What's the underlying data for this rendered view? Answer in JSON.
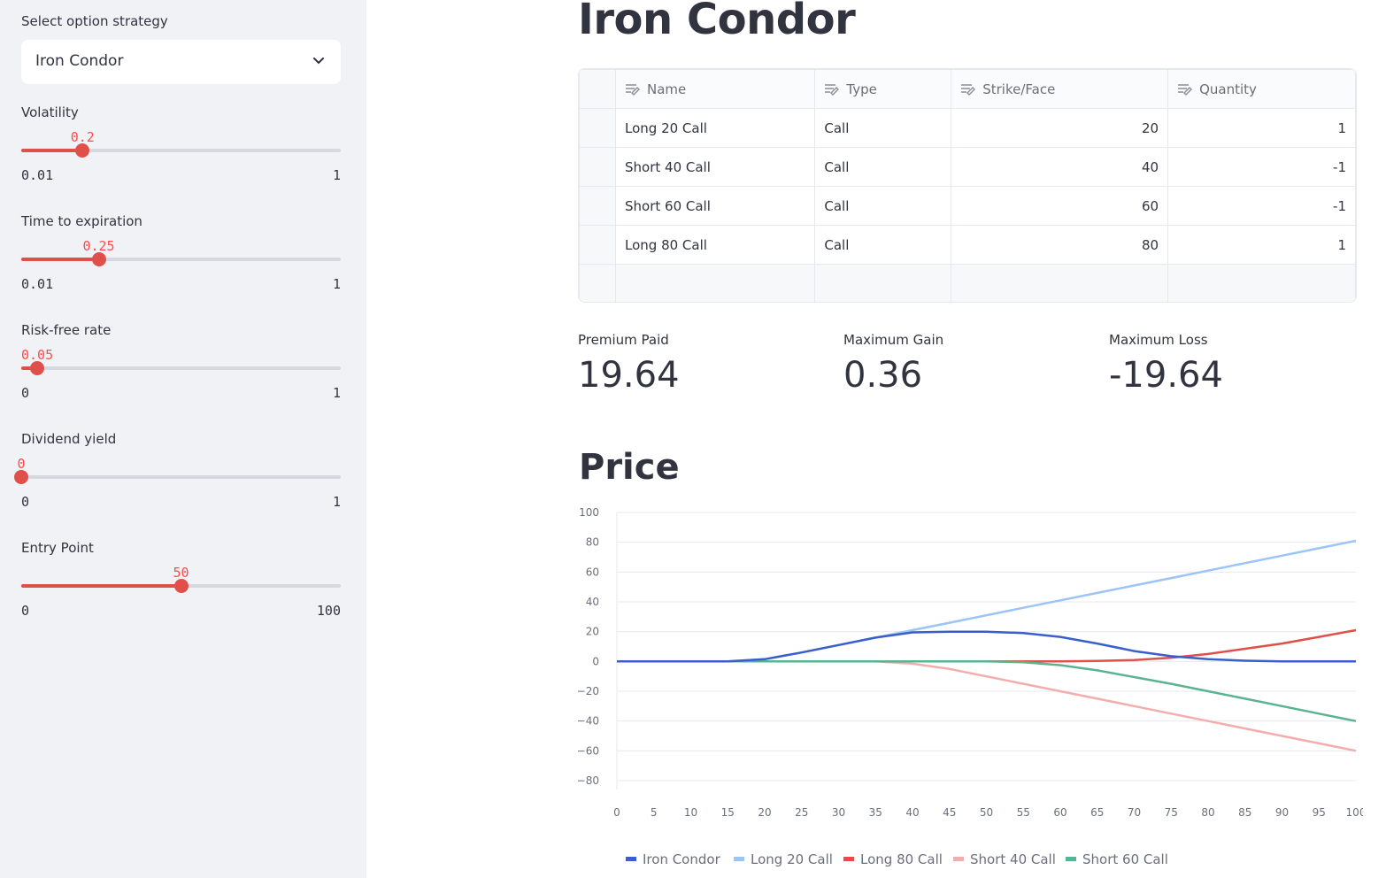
{
  "sidebar": {
    "strategy_label": "Select option strategy",
    "strategy_value": "Iron Condor",
    "sliders": [
      {
        "label": "Volatility",
        "value": 0.2,
        "value_text": "0.2",
        "min": 0.01,
        "max": 1,
        "min_text": "0.01",
        "max_text": "1"
      },
      {
        "label": "Time to expiration",
        "value": 0.25,
        "value_text": "0.25",
        "min": 0.01,
        "max": 1,
        "min_text": "0.01",
        "max_text": "1"
      },
      {
        "label": "Risk-free rate",
        "value": 0.05,
        "value_text": "0.05",
        "min": 0,
        "max": 1,
        "min_text": "0",
        "max_text": "1"
      },
      {
        "label": "Dividend yield",
        "value": 0,
        "value_text": "0",
        "min": 0,
        "max": 1,
        "min_text": "0",
        "max_text": "1"
      },
      {
        "label": "Entry Point",
        "value": 50,
        "value_text": "50",
        "min": 0,
        "max": 100,
        "min_text": "0",
        "max_text": "100"
      }
    ],
    "accent_color": "#e0504a"
  },
  "main": {
    "title": "Iron Condor",
    "table": {
      "columns": [
        "Name",
        "Type",
        "Strike/Face",
        "Quantity"
      ],
      "rows": [
        [
          "Long 20 Call",
          "Call",
          "20",
          "1"
        ],
        [
          "Short 40 Call",
          "Call",
          "40",
          "-1"
        ],
        [
          "Short 60 Call",
          "Call",
          "60",
          "-1"
        ],
        [
          "Long 80 Call",
          "Call",
          "80",
          "1"
        ]
      ]
    },
    "metrics": [
      {
        "label": "Premium Paid",
        "value": "19.64"
      },
      {
        "label": "Maximum Gain",
        "value": "0.36"
      },
      {
        "label": "Maximum Loss",
        "value": "-19.64"
      }
    ],
    "chart_title": "Price"
  },
  "chart_data": {
    "type": "line",
    "x": [
      0,
      5,
      10,
      15,
      20,
      25,
      30,
      35,
      40,
      45,
      50,
      55,
      60,
      65,
      70,
      75,
      80,
      85,
      90,
      95,
      100
    ],
    "xticks": [
      "0",
      "5",
      "10",
      "15",
      "20",
      "25",
      "30",
      "35",
      "40",
      "45",
      "50",
      "55",
      "60",
      "65",
      "70",
      "75",
      "80",
      "85",
      "90",
      "95",
      "100"
    ],
    "yticks": [
      "100",
      "80",
      "60",
      "40",
      "20",
      "0",
      "−20",
      "−40",
      "−60",
      "−80"
    ],
    "ylim": [
      -80,
      100
    ],
    "grid": true,
    "legend": "bottom",
    "series": [
      {
        "name": "Iron Condor",
        "color": "#3a5ecb",
        "values": [
          0,
          0,
          0,
          0,
          1.5,
          6,
          11,
          16,
          19.5,
          20,
          20,
          19,
          16.5,
          12,
          7,
          3.5,
          1.5,
          0.5,
          0,
          0,
          0
        ]
      },
      {
        "name": "Long 20 Call",
        "color": "#9bc4f7",
        "values": [
          0,
          0,
          0,
          0,
          1.5,
          6,
          11,
          16,
          21,
          26,
          31,
          36,
          41,
          46,
          51,
          56,
          61,
          66,
          71,
          76,
          81
        ]
      },
      {
        "name": "Long 80 Call",
        "color": "#e0504a",
        "values": [
          0,
          0,
          0,
          0,
          0,
          0,
          0,
          0,
          0,
          0,
          0,
          0,
          0,
          0.3,
          1,
          2.5,
          5,
          8.5,
          12,
          16.5,
          21
        ]
      },
      {
        "name": "Short 40 Call",
        "color": "#f2aeae",
        "values": [
          0,
          0,
          0,
          0,
          0,
          0,
          0,
          0,
          -1.5,
          -5,
          -10,
          -15,
          -20,
          -25,
          -30,
          -35,
          -40,
          -45,
          -50,
          -55,
          -60
        ]
      },
      {
        "name": "Short 60 Call",
        "color": "#5bb391",
        "values": [
          0,
          0,
          0,
          0,
          0,
          0,
          0,
          0,
          0,
          0,
          0,
          -0.5,
          -2.5,
          -6,
          -10.5,
          -15,
          -20,
          -25,
          -30,
          -35,
          -40
        ]
      }
    ]
  }
}
